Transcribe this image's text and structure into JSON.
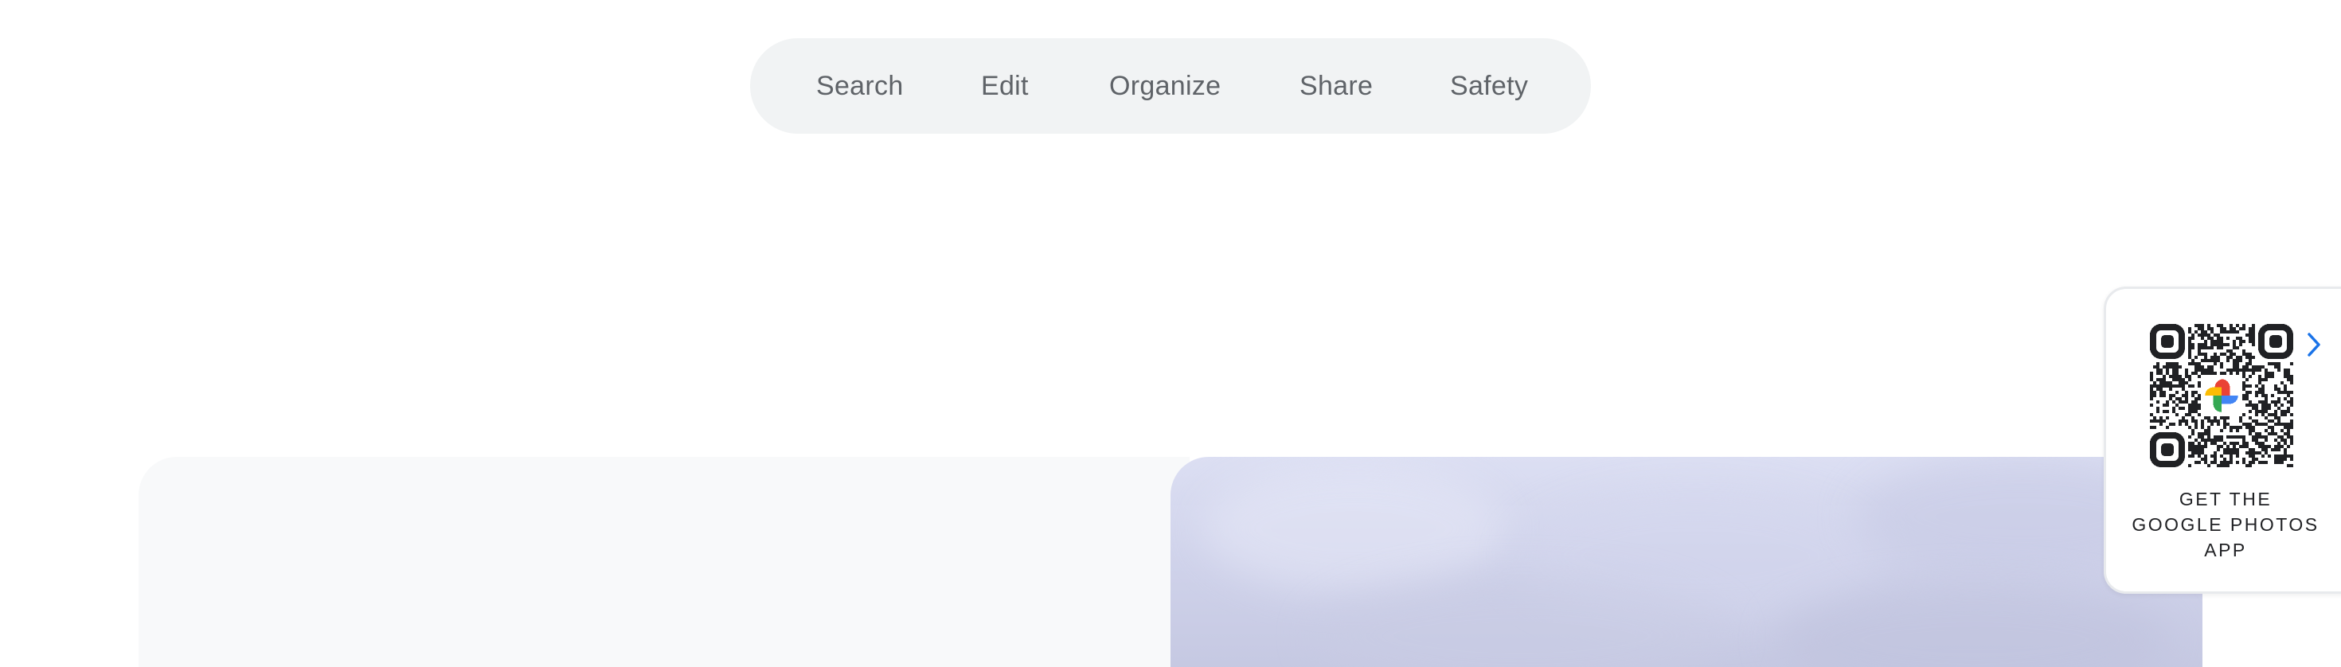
{
  "nav": {
    "items": [
      {
        "label": "Search"
      },
      {
        "label": "Edit"
      },
      {
        "label": "Organize"
      },
      {
        "label": "Share"
      },
      {
        "label": "Safety"
      }
    ]
  },
  "app_promo": {
    "lines": [
      "GET THE",
      "GOOGLE PHOTOS",
      "APP"
    ],
    "qr_icon": "qr-code-icon",
    "logo_icon": "google-photos-pinwheel-icon",
    "chevron_icon": "chevron-right-icon",
    "accent_color": "#1a73e8"
  },
  "colors": {
    "nav_background": "#f1f3f4",
    "nav_text": "#5f6368",
    "card_background": "#f8f9fa",
    "photo_tint": "#cfd2ea"
  }
}
